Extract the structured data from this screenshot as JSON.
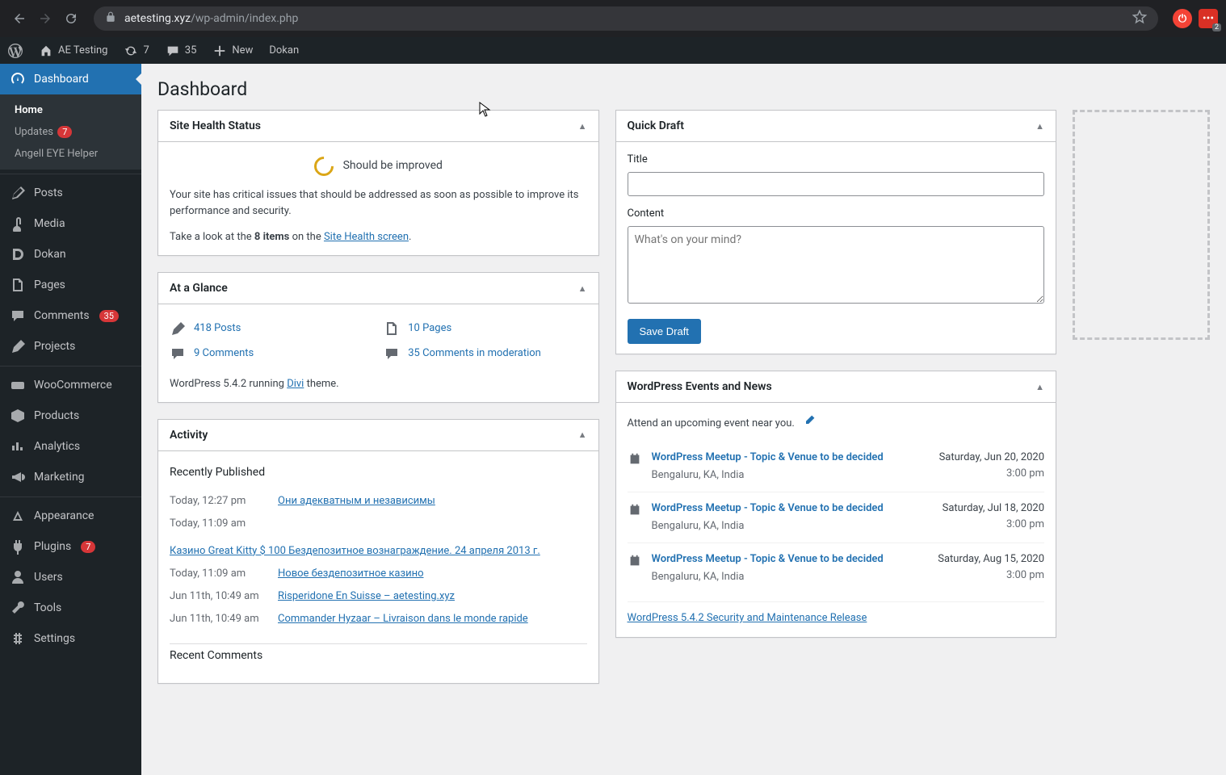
{
  "browser": {
    "url_host": "aetesting.xyz",
    "url_path": "/wp-admin/index.php",
    "ext_badge": "2"
  },
  "adminbar": {
    "site_name": "AE Testing",
    "updates": "7",
    "comments": "35",
    "new_label": "New",
    "dokan": "Dokan"
  },
  "sidebar": {
    "dashboard": "Dashboard",
    "sub_home": "Home",
    "sub_updates": "Updates",
    "sub_updates_count": "7",
    "sub_helper": "Angell EYE Helper",
    "posts": "Posts",
    "media": "Media",
    "dokan": "Dokan",
    "pages": "Pages",
    "comments": "Comments",
    "comments_count": "35",
    "projects": "Projects",
    "woocommerce": "WooCommerce",
    "products": "Products",
    "analytics": "Analytics",
    "marketing": "Marketing",
    "appearance": "Appearance",
    "plugins": "Plugins",
    "plugins_count": "7",
    "users": "Users",
    "tools": "Tools",
    "settings": "Settings"
  },
  "page_title": "Dashboard",
  "site_health": {
    "heading": "Site Health Status",
    "status": "Should be improved",
    "desc": "Your site has critical issues that should be addressed as soon as possible to improve its performance and security.",
    "take_look_pre": "Take a look at the ",
    "items_count": "8 items",
    "take_look_mid": " on the ",
    "screen_link": "Site Health screen",
    "period": "."
  },
  "glance": {
    "heading": "At a Glance",
    "posts": "418 Posts",
    "pages": "10 Pages",
    "comments": "9 Comments",
    "moderation": "35 Comments in moderation",
    "version_pre": "WordPress 5.4.2 running ",
    "theme": "Divi",
    "version_post": " theme."
  },
  "activity": {
    "heading": "Activity",
    "recently": "Recently Published",
    "rows": [
      {
        "date": "Today, 12:27 pm",
        "title": "Они адекватным и независимы"
      },
      {
        "date": "Today, 11:09 am",
        "title": "Казино Great Kitty $ 100 Бездепозитное вознаграждение. 24 апреля 2013 г."
      },
      {
        "date": "Today, 11:09 am",
        "title": "Новое бездепозитное казино"
      },
      {
        "date": "Jun 11th, 10:49 am",
        "title": "Risperidone En Suisse – aetesting.xyz"
      },
      {
        "date": "Jun 11th, 10:49 am",
        "title": "Commander Hyzaar – Livraison dans le monde rapide"
      }
    ],
    "recent_comments": "Recent Comments"
  },
  "quick_draft": {
    "heading": "Quick Draft",
    "title_label": "Title",
    "content_label": "Content",
    "content_placeholder": "What's on your mind?",
    "save_button": "Save Draft"
  },
  "events": {
    "heading": "WordPress Events and News",
    "attend": "Attend an upcoming event near you.",
    "items": [
      {
        "title": "WordPress Meetup - Topic & Venue to be decided",
        "location": "Bengaluru, KA, India",
        "date": "Saturday, Jun 20, 2020",
        "time": "3:00 pm"
      },
      {
        "title": "WordPress Meetup - Topic & Venue to be decided",
        "location": "Bengaluru, KA, India",
        "date": "Saturday, Jul 18, 2020",
        "time": "3:00 pm"
      },
      {
        "title": "WordPress Meetup - Topic & Venue to be decided",
        "location": "Bengaluru, KA, India",
        "date": "Saturday, Aug 15, 2020",
        "time": "3:00 pm"
      }
    ],
    "news_link": "WordPress 5.4.2 Security and Maintenance Release"
  }
}
